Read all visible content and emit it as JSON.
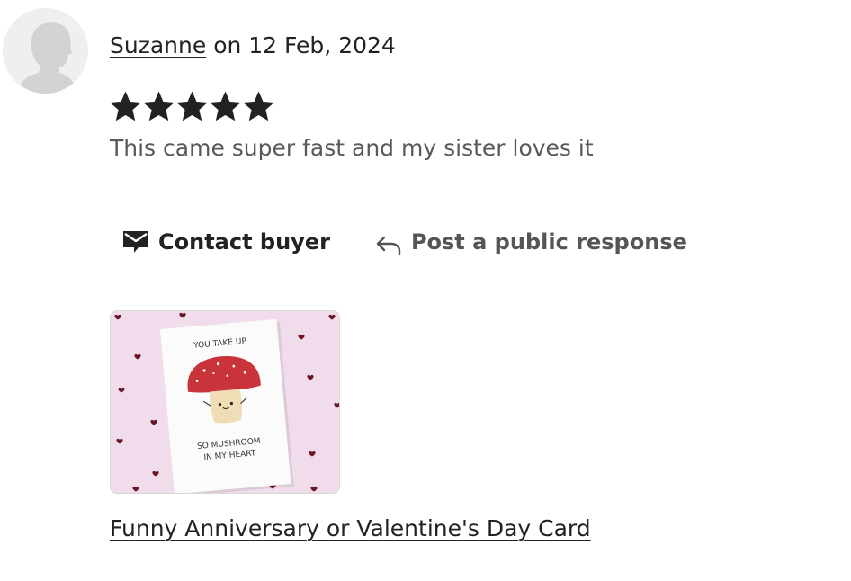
{
  "review": {
    "user_name": "Suzanne",
    "date_text": "on 12 Feb, 2024",
    "rating": 5,
    "rating_max": 5,
    "text": "This came super fast and my sister loves it"
  },
  "actions": {
    "contact_label": "Contact buyer",
    "respond_label": "Post a public response"
  },
  "product": {
    "card_text_top": "YOU TAKE UP",
    "card_text_bottom_1": "SO MUSHROOM",
    "card_text_bottom_2": "IN MY HEART",
    "link_text": "Funny Anniversary or Valentine's Day Card"
  },
  "colors": {
    "text": "#222222",
    "muted": "#595959",
    "star": "#222222",
    "thumb_bg": "#f0dcea",
    "mushroom_red": "#c8343a"
  },
  "icons": {
    "avatar": "default-user-silhouette",
    "contact": "envelope-icon",
    "respond": "reply-arrow-icon",
    "star": "star-icon"
  }
}
